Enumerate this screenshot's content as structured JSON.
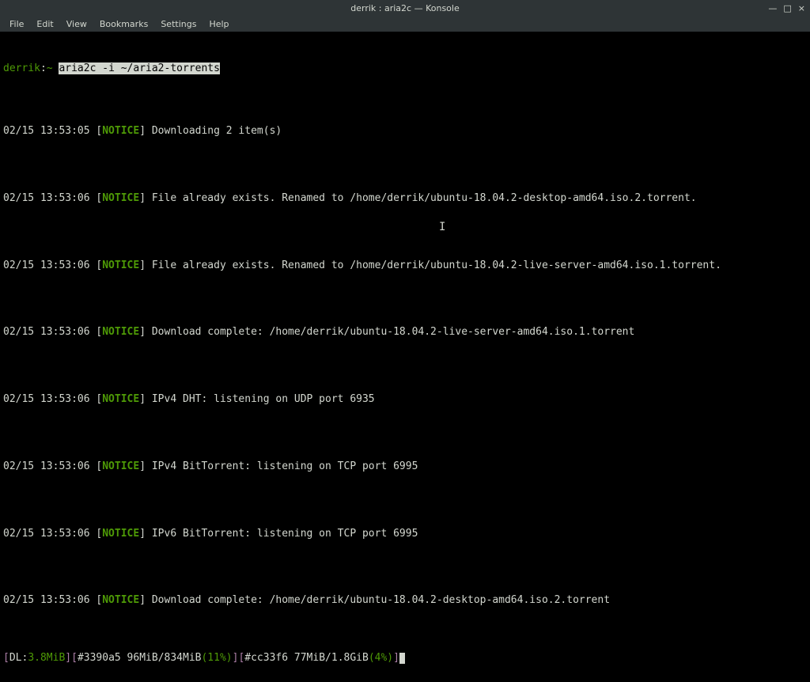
{
  "window": {
    "title": "derrik : aria2c — Konsole",
    "controls": {
      "min": "—",
      "max": "□",
      "close": "×"
    }
  },
  "menu": {
    "items": [
      "File",
      "Edit",
      "View",
      "Bookmarks",
      "Settings",
      "Help"
    ]
  },
  "prompt": {
    "user": "derrik",
    "sep": ":",
    "path": "~",
    "command": "aria2c -i ~/aria2-torrents"
  },
  "logs": [
    {
      "ts": "02/15 13:53:05",
      "tag": "NOTICE",
      "msg": "Downloading 2 item(s)"
    },
    {
      "ts": "02/15 13:53:06",
      "tag": "NOTICE",
      "msg": "File already exists. Renamed to /home/derrik/ubuntu-18.04.2-desktop-amd64.iso.2.torrent."
    },
    {
      "ts": "02/15 13:53:06",
      "tag": "NOTICE",
      "msg": "File already exists. Renamed to /home/derrik/ubuntu-18.04.2-live-server-amd64.iso.1.torrent."
    },
    {
      "ts": "02/15 13:53:06",
      "tag": "NOTICE",
      "msg": "Download complete: /home/derrik/ubuntu-18.04.2-live-server-amd64.iso.1.torrent"
    },
    {
      "ts": "02/15 13:53:06",
      "tag": "NOTICE",
      "msg": "IPv4 DHT: listening on UDP port 6935"
    },
    {
      "ts": "02/15 13:53:06",
      "tag": "NOTICE",
      "msg": "IPv4 BitTorrent: listening on TCP port 6995"
    },
    {
      "ts": "02/15 13:53:06",
      "tag": "NOTICE",
      "msg": "IPv6 BitTorrent: listening on TCP port 6995"
    },
    {
      "ts": "02/15 13:53:06",
      "tag": "NOTICE",
      "msg": "Download complete: /home/derrik/ubuntu-18.04.2-desktop-amd64.iso.2.torrent"
    }
  ],
  "status": {
    "dl_label": "DL:",
    "dl_speed": "3.8MiB",
    "item1_id": "#3390a5",
    "item1_progress": " 96MiB/834MiB",
    "item1_pct": "(11%)",
    "item2_id": "#cc33f6",
    "item2_progress": " 77MiB/1.8GiB",
    "item2_pct": "(4%)",
    "lb": "[",
    "rb": "]"
  }
}
